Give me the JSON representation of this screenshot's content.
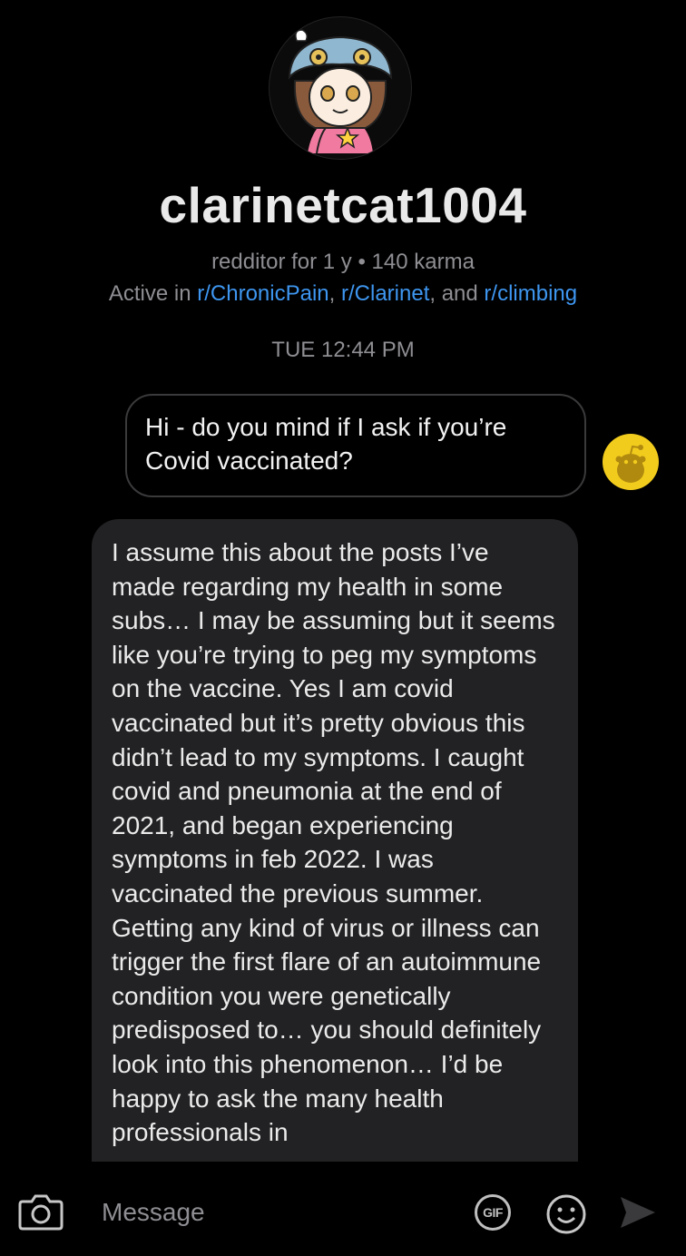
{
  "profile": {
    "username": "clarinetcat1004",
    "meta": "redditor for 1 y • 140 karma",
    "active_prefix": "Active in ",
    "subreddits": [
      "r/ChronicPain",
      "r/Clarinet",
      "r/climbing"
    ],
    "sep1": ", ",
    "sep2": ", and "
  },
  "timestamp": "TUE 12:44 PM",
  "messages": {
    "sent": "Hi - do you mind if I ask if you’re Covid vaccinated?",
    "received": "I assume this about the posts I’ve made regarding my health in some subs… I may be assuming but it seems like you’re trying to peg my symptoms on the vaccine. Yes I am covid vaccinated but it’s pretty obvious this didn’t lead to my symptoms. I caught covid and pneumonia at the end of 2021, and began experiencing symptoms in feb 2022. I was vaccinated the previous summer. Getting any kind of virus or illness can trigger the first flare of an autoimmune condition you were genetically predisposed to… you should definitely look into this phenomenon… I’d be happy to ask the many health professionals in"
  },
  "composer": {
    "placeholder": "Message",
    "gif_label": "GIF"
  },
  "icons": {
    "camera": "camera-icon",
    "emoji": "emoji-icon",
    "send": "send-icon"
  },
  "colors": {
    "link": "#3e96f0",
    "muted": "#8e8e93",
    "bubble": "#222224",
    "reddit_avatar": "#f2cc1d"
  }
}
